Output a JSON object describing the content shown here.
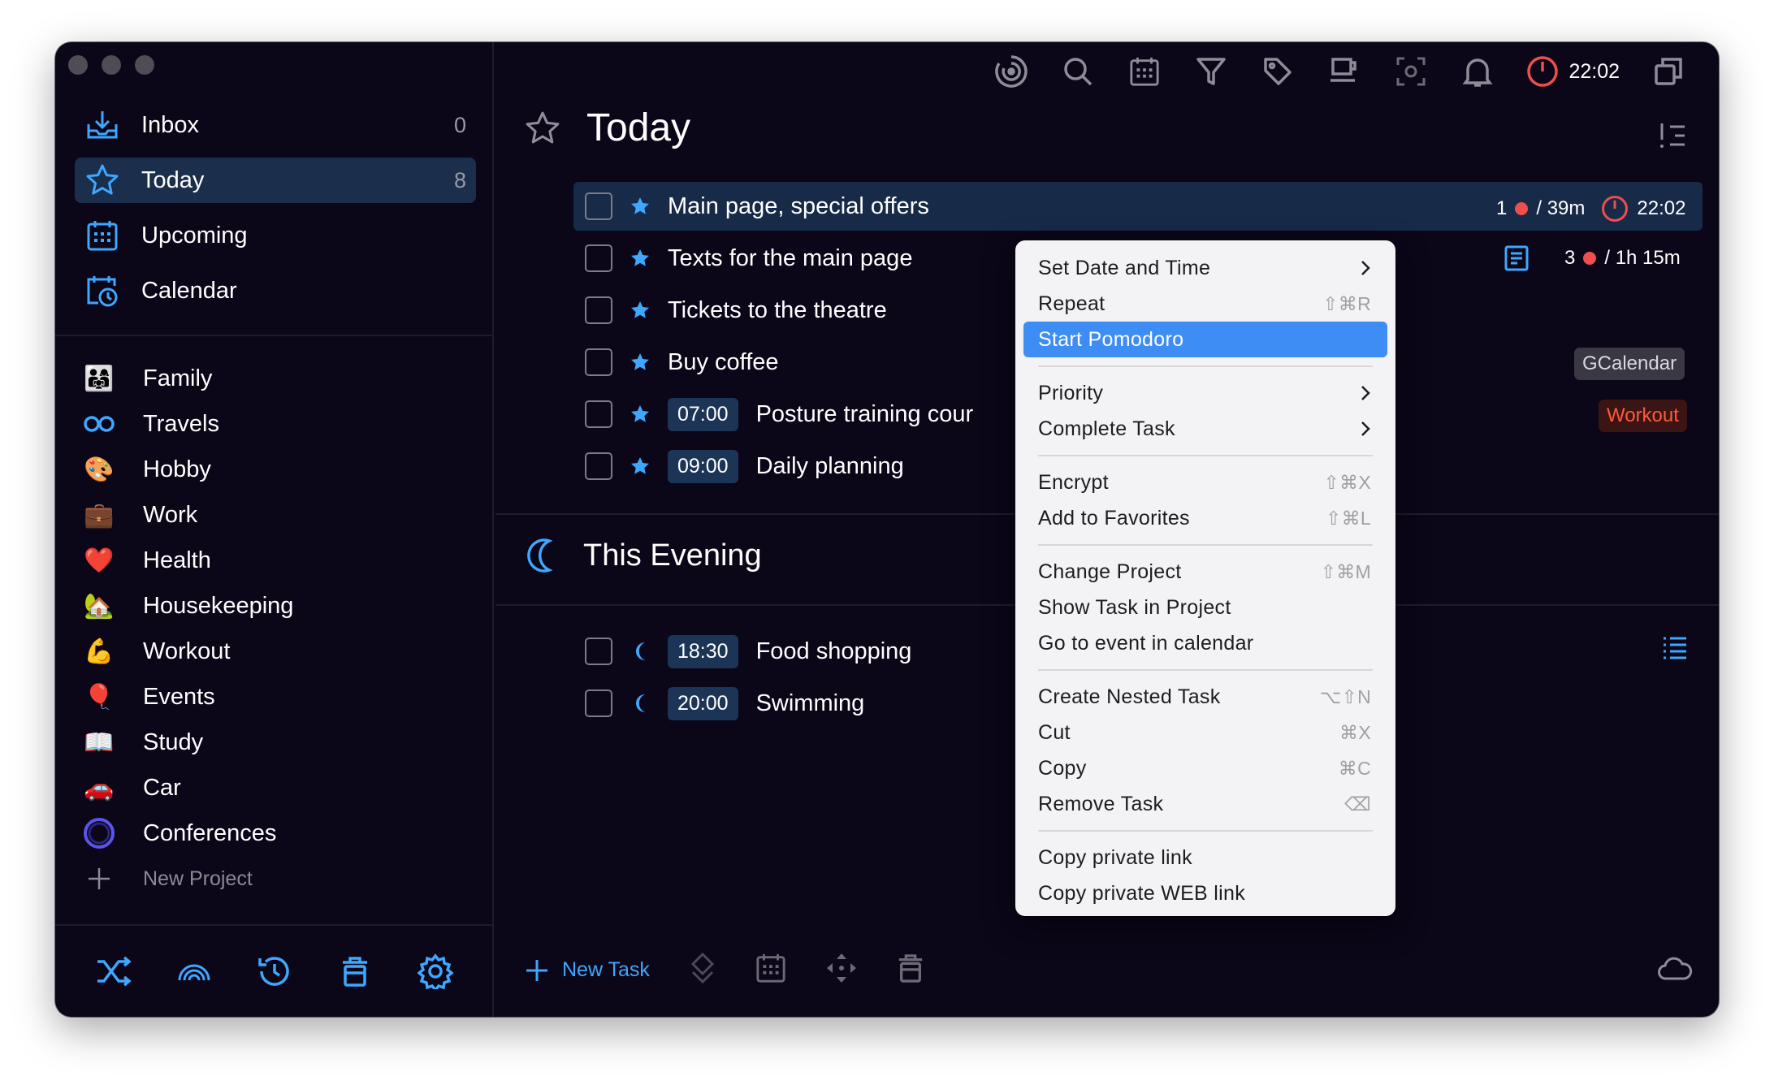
{
  "sidebar": {
    "nav": [
      {
        "label": "Inbox",
        "count": "0",
        "icon": "inbox-icon"
      },
      {
        "label": "Today",
        "count": "8",
        "icon": "star-icon"
      },
      {
        "label": "Upcoming",
        "count": "",
        "icon": "calendar-grid-icon"
      },
      {
        "label": "Calendar",
        "count": "",
        "icon": "calendar-clock-icon"
      }
    ],
    "projects": [
      {
        "label": "Family",
        "emoji": "👨‍👩‍👧"
      },
      {
        "label": "Travels",
        "emoji": "∞"
      },
      {
        "label": "Hobby",
        "emoji": "🎨"
      },
      {
        "label": "Work",
        "emoji": "💼"
      },
      {
        "label": "Health",
        "emoji": "❤️"
      },
      {
        "label": "Housekeeping",
        "emoji": "🏡"
      },
      {
        "label": "Workout",
        "emoji": "💪"
      },
      {
        "label": "Events",
        "emoji": "🎈"
      },
      {
        "label": "Study",
        "emoji": "📖"
      },
      {
        "label": "Car",
        "emoji": "🚗"
      },
      {
        "label": "Conferences",
        "emoji": "◯"
      }
    ],
    "new_project": "New Project",
    "bottom_icons": [
      "shuffle-icon",
      "rainbow-icon",
      "history-icon",
      "trash-icon",
      "settings-icon"
    ]
  },
  "toolbar": {
    "icons": [
      "focus-icon",
      "search-icon",
      "calendar-icon",
      "filter-icon",
      "tag-icon",
      "coffee-icon",
      "screenshot-icon",
      "bell-icon"
    ],
    "timer": "22:02"
  },
  "main": {
    "title": "Today",
    "evening_title": "This Evening",
    "tasks": [
      {
        "title": "Main page, special offers",
        "time": ""
      },
      {
        "title": "Texts for the main page",
        "time": ""
      },
      {
        "title": "Tickets to the theatre",
        "time": ""
      },
      {
        "title": "Buy coffee",
        "time": ""
      },
      {
        "title": "Posture training cour",
        "time": "07:00"
      },
      {
        "title": "Daily planning",
        "time": "09:00"
      }
    ],
    "evening_tasks": [
      {
        "title": "Food shopping",
        "time": "18:30"
      },
      {
        "title": "Swimming",
        "time": "20:00"
      }
    ],
    "task0_meta": {
      "count": "1",
      "duration": "/ 39m",
      "timer": "22:02"
    },
    "task1_meta": {
      "count": "3",
      "duration": "/ 1h 15m"
    },
    "tags": {
      "gcal": "GCalendar",
      "workout": "Workout"
    },
    "new_task": "New Task"
  },
  "context_menu": {
    "groups": [
      [
        {
          "label": "Set Date and Time",
          "shortcut": "",
          "submenu": true
        },
        {
          "label": "Repeat",
          "shortcut": "⇧⌘R",
          "submenu": false
        },
        {
          "label": "Start Pomodoro",
          "shortcut": "",
          "submenu": false,
          "highlighted": true
        }
      ],
      [
        {
          "label": "Priority",
          "shortcut": "",
          "submenu": true
        },
        {
          "label": "Complete Task",
          "shortcut": "",
          "submenu": true
        }
      ],
      [
        {
          "label": "Encrypt",
          "shortcut": "⇧⌘X",
          "submenu": false
        },
        {
          "label": "Add to Favorites",
          "shortcut": "⇧⌘L",
          "submenu": false
        }
      ],
      [
        {
          "label": "Change Project",
          "shortcut": "⇧⌘M",
          "submenu": false
        },
        {
          "label": "Show Task in Project",
          "shortcut": "",
          "submenu": false
        },
        {
          "label": "Go to event in calendar",
          "shortcut": "",
          "submenu": false
        }
      ],
      [
        {
          "label": "Create Nested Task",
          "shortcut": "⌥⇧N",
          "submenu": false
        },
        {
          "label": "Cut",
          "shortcut": "⌘X",
          "submenu": false
        },
        {
          "label": "Copy",
          "shortcut": "⌘C",
          "submenu": false
        },
        {
          "label": "Remove Task",
          "shortcut": "⌫",
          "submenu": false
        }
      ],
      [
        {
          "label": "Copy private link",
          "shortcut": "",
          "submenu": false
        },
        {
          "label": "Copy private WEB link",
          "shortcut": "",
          "submenu": false
        }
      ]
    ]
  },
  "colors": {
    "accent": "#3ea7ff",
    "background": "#0b0618",
    "selection": "#172a48",
    "menu_highlight": "#3d8df4",
    "timer_red": "#ee4e4e"
  }
}
